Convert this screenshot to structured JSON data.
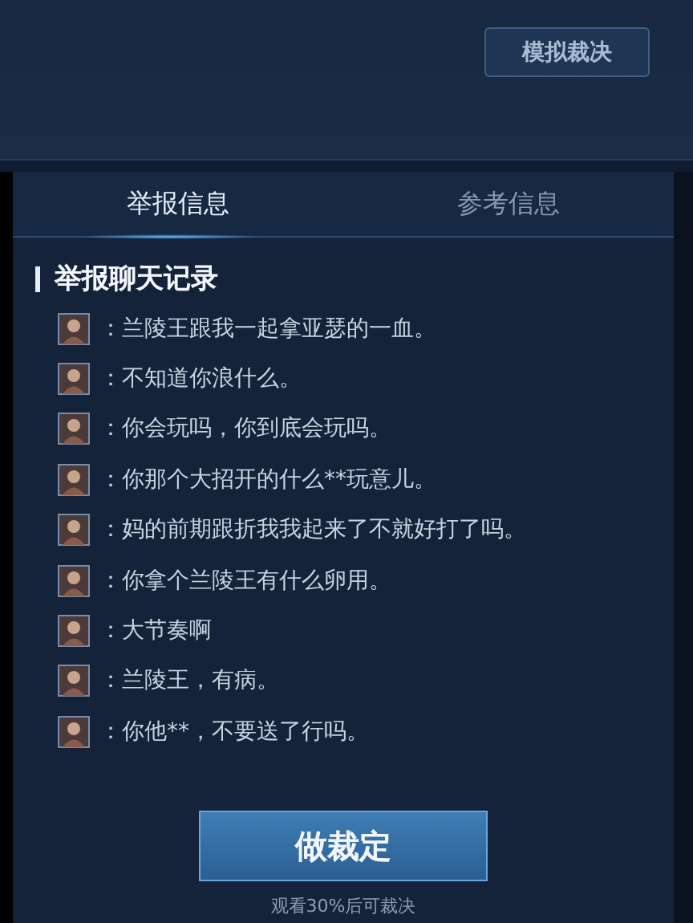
{
  "top_button": "模拟裁决",
  "tabs": [
    {
      "label": "举报信息",
      "selected": true
    },
    {
      "label": "参考信息",
      "selected": false
    }
  ],
  "section_title": "举报聊天记录",
  "chat": [
    {
      "separator": "：",
      "text": "兰陵王跟我一起拿亚瑟的一血。"
    },
    {
      "separator": "：",
      "text": "不知道你浪什么。"
    },
    {
      "separator": "：",
      "text": "你会玩吗，你到底会玩吗。"
    },
    {
      "separator": "：",
      "text": "你那个大招开的什么**玩意儿。"
    },
    {
      "separator": "：",
      "text": "妈的前期跟折我我起来了不就好打了吗。"
    },
    {
      "separator": "：",
      "text": "你拿个兰陵王有什么卵用。"
    },
    {
      "separator": "：",
      "text": "大节奏啊"
    },
    {
      "separator": "：",
      "text": "兰陵王，有病。"
    },
    {
      "separator": "：",
      "text": "你他**，不要送了行吗。"
    }
  ],
  "main_button": "做裁定",
  "hint": "观看30%后可裁决"
}
